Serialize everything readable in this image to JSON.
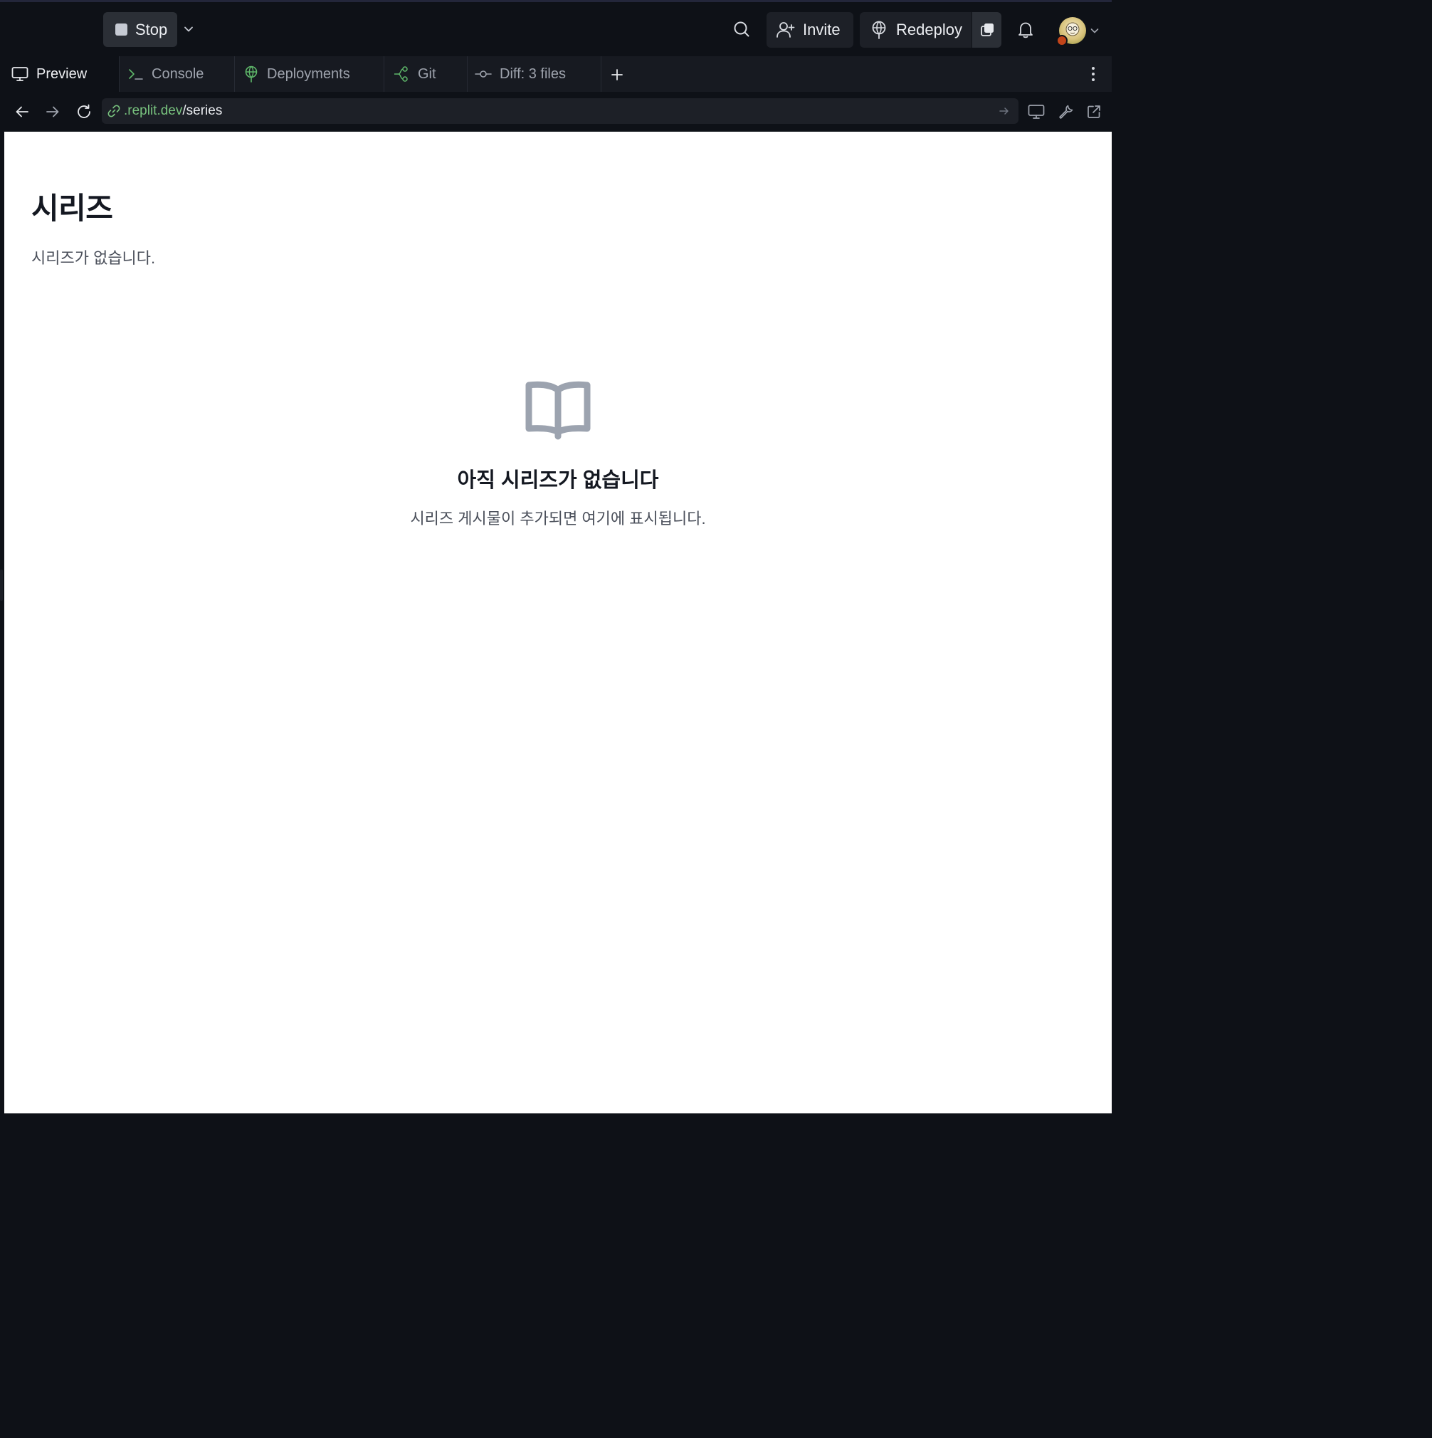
{
  "topbar": {
    "stop_label": "Stop",
    "invite_label": "Invite",
    "redeploy_label": "Redeploy"
  },
  "tabs": [
    {
      "label": "Preview",
      "icon": "monitor-icon",
      "active": true
    },
    {
      "label": "Console",
      "icon": "terminal-icon",
      "active": false
    },
    {
      "label": "Deployments",
      "icon": "deployments-icon",
      "active": false
    },
    {
      "label": "Git",
      "icon": "git-branch-icon",
      "active": false
    },
    {
      "label": "Diff: 3 files",
      "icon": "git-commit-icon",
      "active": false
    }
  ],
  "address": {
    "host": ".replit.dev",
    "path": "/series"
  },
  "page": {
    "title": "시리즈",
    "subtitle": "시리즈가 없습니다.",
    "empty_heading": "아직 시리즈가 없습니다",
    "empty_text": "시리즈 게시물이 추가되면 여기에 표시됩니다."
  },
  "colors": {
    "chrome_bg": "#0e1117",
    "tab_bar_bg": "#171a21",
    "url_host": "#78c27e",
    "deploy_icon": "#5fb86a",
    "avatar_badge": "#c2451a"
  }
}
